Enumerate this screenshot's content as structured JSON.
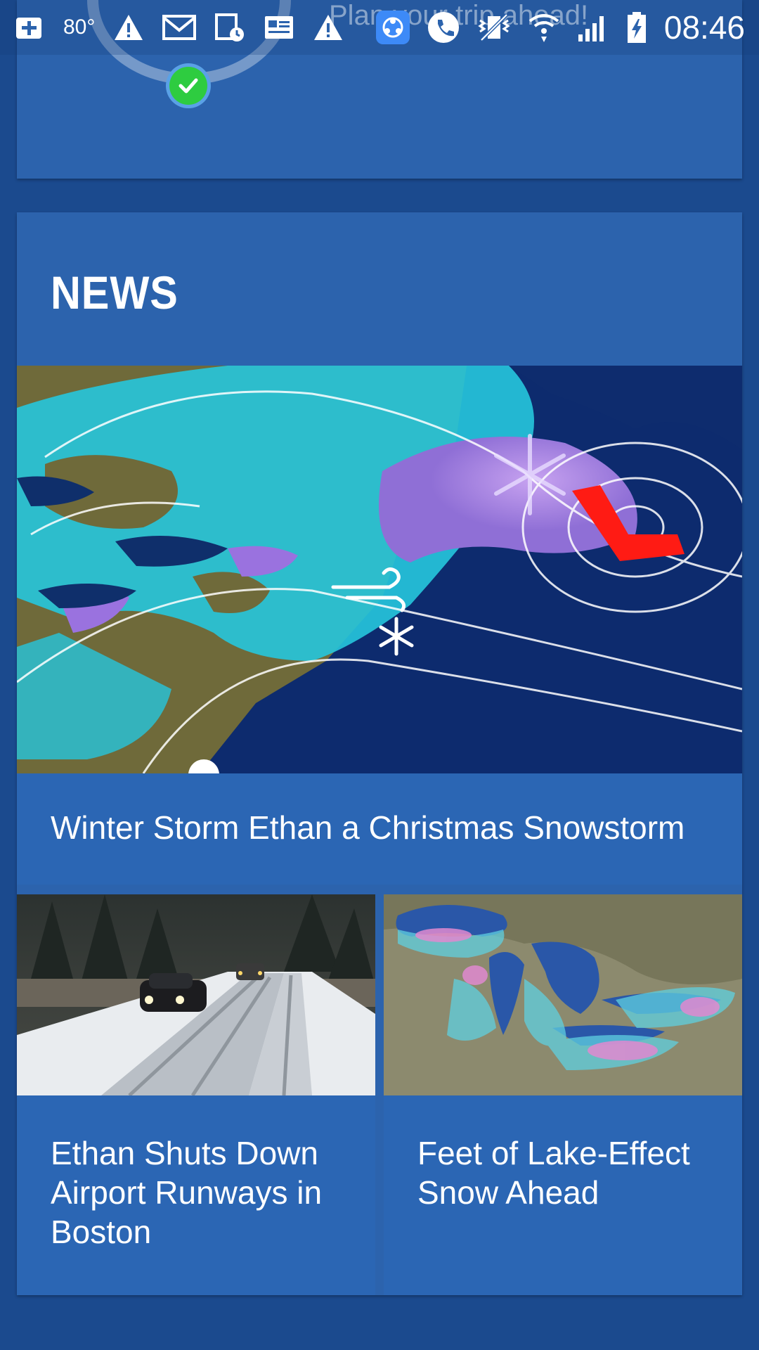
{
  "status_bar": {
    "temperature": "80°",
    "ghost_text": "Plan your trip ahead!",
    "time": "08:46",
    "left_icons": [
      "add-icon",
      "warning-icon",
      "gmail-icon",
      "calendar-clock-icon",
      "news-card-icon",
      "warning-icon"
    ],
    "right_icons": [
      "app-share-icon",
      "phone-icon",
      "vibrate-icon",
      "wifi-icon",
      "signal-icon",
      "battery-charging-icon"
    ]
  },
  "news": {
    "title": "NEWS",
    "featured": {
      "headline": "Winter Storm Ethan a Christmas Snowstorm",
      "image": "storm-map-image"
    },
    "articles": [
      {
        "headline": "Ethan Shuts Down Airport Runways in Boston",
        "image": "snowy-road-image"
      },
      {
        "headline": "Feet of Lake-Effect Snow Ahead",
        "image": "great-lakes-satellite-image"
      }
    ]
  },
  "colors": {
    "background": "#1b4a8e",
    "card": "#2c63ad",
    "check": "#2ecc40"
  }
}
